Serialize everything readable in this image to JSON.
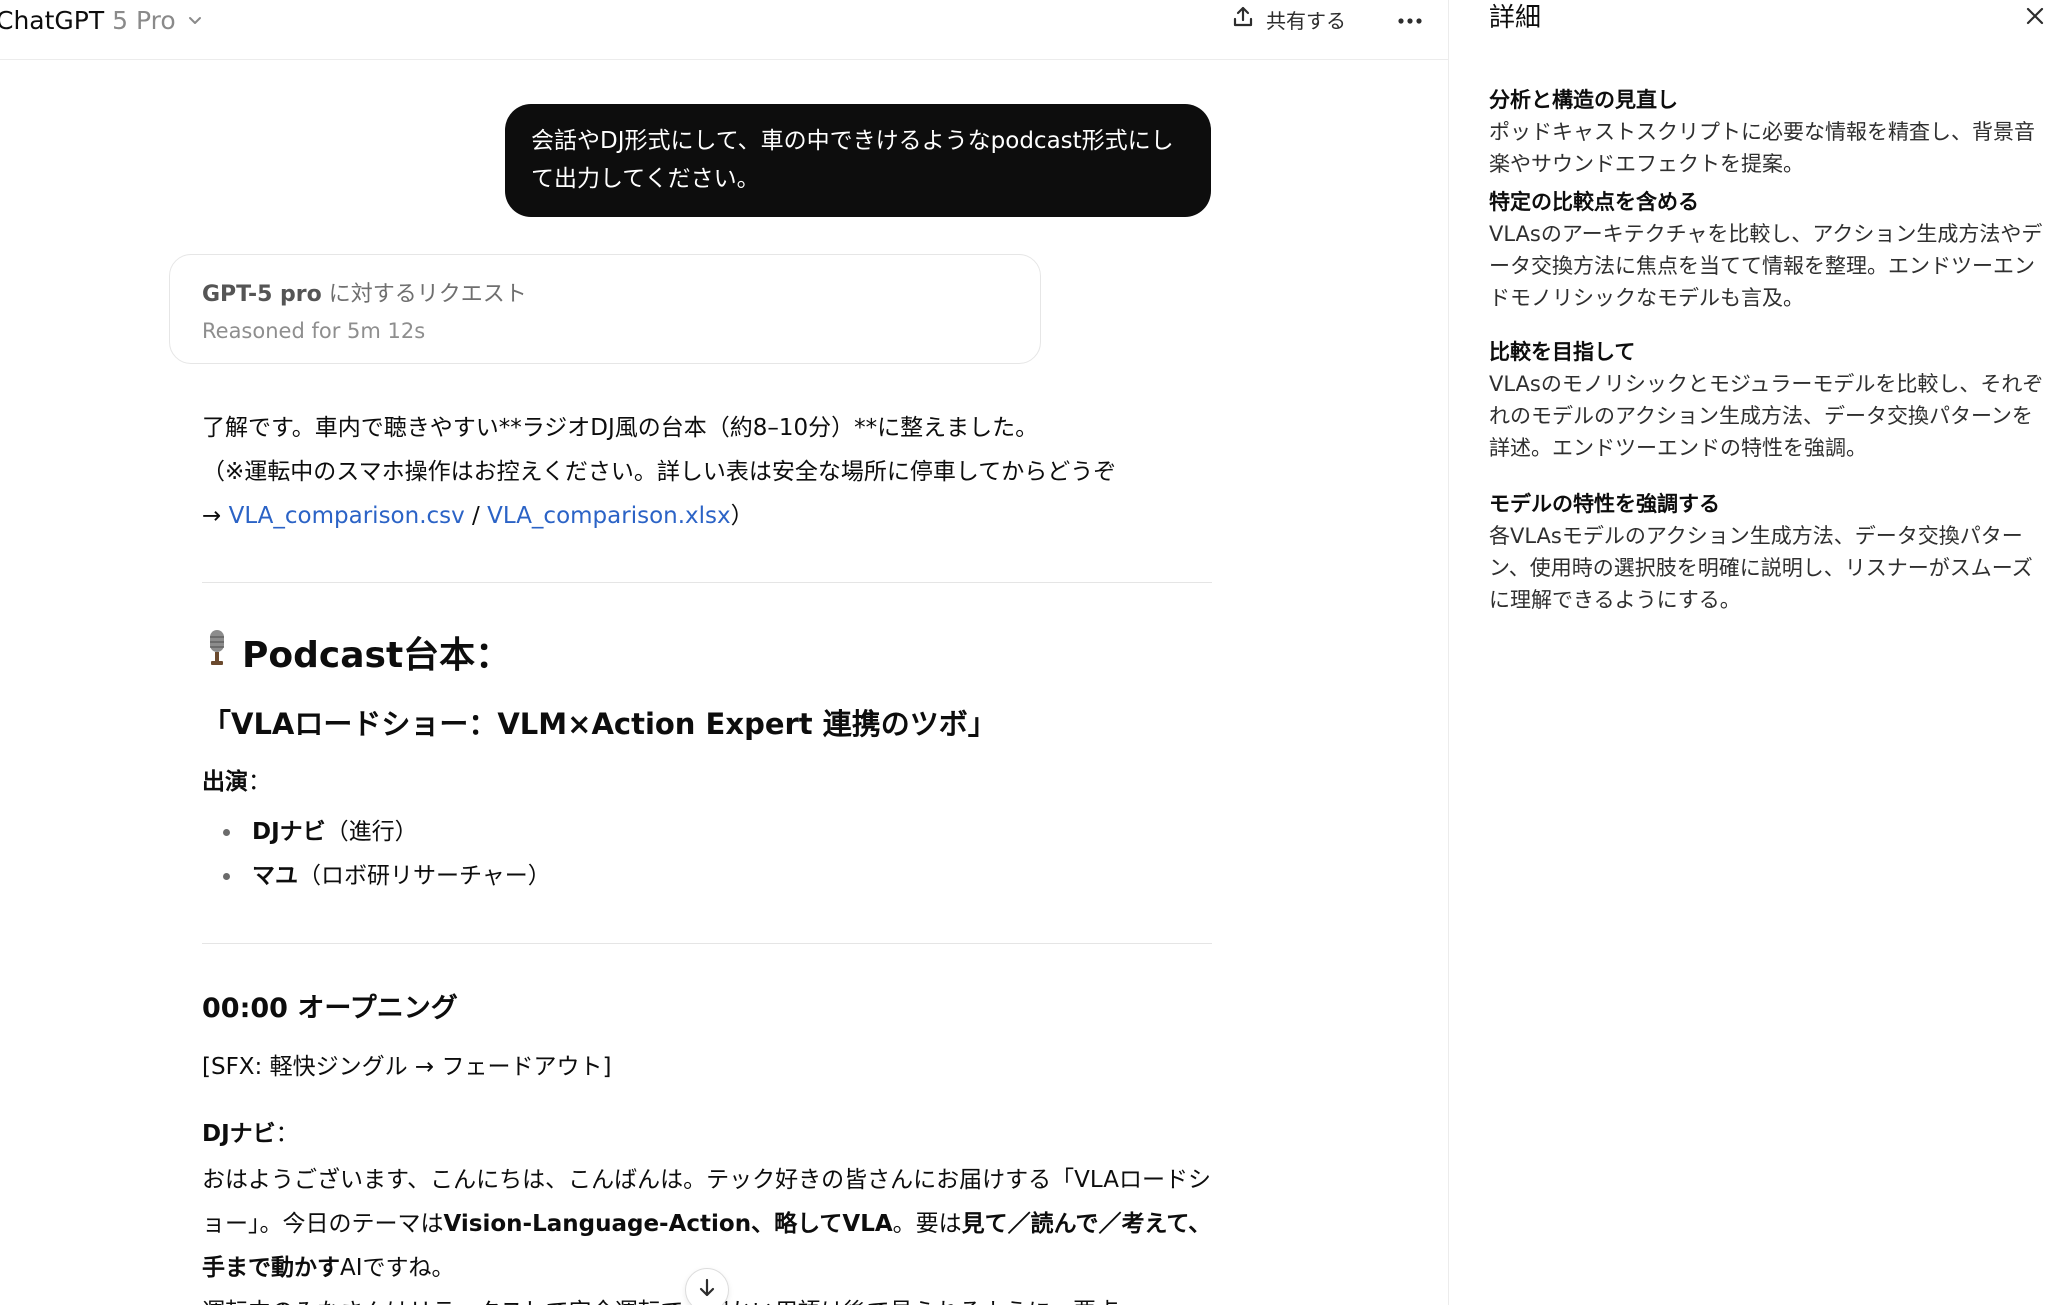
{
  "header": {
    "brand": "ChatGPT",
    "model_variant": "5 Pro",
    "share_label": "共有する"
  },
  "user_message": "会話やDJ形式にして、車の中できけるようなpodcast形式にして出力してください。",
  "reasoning": {
    "model": "GPT-5 pro",
    "request_label": " に対するリクエスト",
    "duration": "Reasoned for 5m 12s"
  },
  "response": {
    "intro_line1": "了解です。車内で聴きやすい**ラジオDJ風の台本（約8–10分）**に整えました。",
    "intro_line2": "（※運転中のスマホ操作はお控えください。詳しい表は安全な場所に停車してからどうぞ",
    "arrow": "→ ",
    "link_csv": "VLA_comparison.csv",
    "link_sep": " / ",
    "link_xlsx": "VLA_comparison.xlsx",
    "intro_close": "）",
    "podcast_heading": "Podcast台本：",
    "episode_title": "「VLAロードショー：VLM×Action Expert 連携のツボ」",
    "cast_label": "出演",
    "cast_colon": "：",
    "cast": [
      {
        "name": "DJナビ",
        "role": "（進行）"
      },
      {
        "name": "マユ",
        "role": "（ロボ研リサーチャー）"
      }
    ],
    "opening_heading": "00:00 オープニング",
    "sfx": "[SFX: 軽快ジングル → フェードアウト]",
    "dj_label": "DJナビ",
    "dj_colon": "：",
    "dj_text_1": "おはようございます、こんにちは、こんばんは。テック好きの皆さんにお届けする「VLAロードショー」。今日のテーマは",
    "dj_text_bold_1": "Vision-Language-Action、略してVLA",
    "dj_text_2": "。要は",
    "dj_text_bold_2": "見て／読んで／考えて、手まで動かす",
    "dj_text_3": "AIですね。",
    "dj_text_cut": "運転中のみなさんはリラックスして安全運転で。細かい用語は後で見られるように、要点"
  },
  "details": {
    "title": "詳細",
    "steps": [
      {
        "title": "分析と構造の見直し",
        "body": "ポッドキャストスクリプトに必要な情報を精査し、背景音楽やサウンドエフェクトを提案。"
      },
      {
        "title": "特定の比較点を含める",
        "body": "VLAsのアーキテクチャを比較し、アクション生成方法やデータ交換方法に焦点を当てて情報を整理。エンドツーエンドモノリシックなモデルも言及。"
      },
      {
        "title": "比較を目指して",
        "body": "VLAsのモノリシックとモジュラーモデルを比較し、それぞれのモデルのアクション生成方法、データ交換パターンを詳述。エンドツーエンドの特性を強調。"
      },
      {
        "title": "モデルの特性を強調する",
        "body": "各VLAsモデルのアクション生成方法、データ交換パターン、使用時の選択肢を明確に説明し、リスナーがスムーズに理解できるようにする。"
      }
    ]
  },
  "icons": {
    "chevron": "chevron-down-icon",
    "share": "share-icon",
    "more": "more-horizontal-icon",
    "microphone": "microphone-icon",
    "close": "close-icon",
    "scroll_down": "arrow-down-icon"
  },
  "colors": {
    "user_bubble": "#0d0d0d",
    "link": "#2b63c6",
    "muted": "#8a8a8a"
  }
}
